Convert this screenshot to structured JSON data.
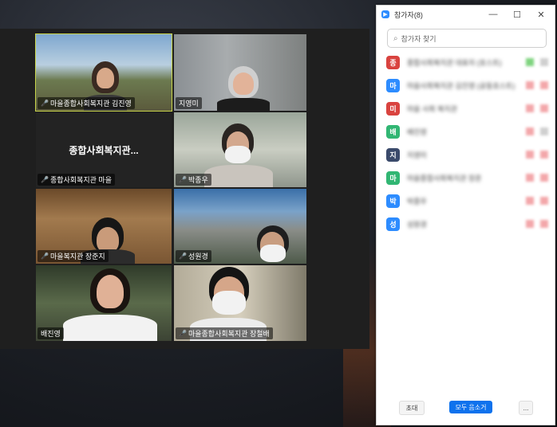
{
  "panel": {
    "title": "참가자(8)",
    "search_placeholder": "참가자 찾기",
    "participants": [
      {
        "initial": "종",
        "name": "종합사회복지관 대표자 (호스트)",
        "color": "#d9433f"
      },
      {
        "initial": "마",
        "name": "마을사회복지관 김진영 (공동호스트)",
        "color": "#2d8cff"
      },
      {
        "initial": "미",
        "name": "마을 사회 복지관",
        "color": "#d9433f"
      },
      {
        "initial": "배",
        "name": "배진영",
        "color": "#31b673"
      },
      {
        "initial": "지",
        "name": "지영미",
        "color": "#3a4a6b"
      },
      {
        "initial": "마",
        "name": "마을종합사회복지관 장준",
        "color": "#31b673"
      },
      {
        "initial": "박",
        "name": "박종우",
        "color": "#2d8cff"
      },
      {
        "initial": "성",
        "name": "성원경",
        "color": "#2d8cff"
      }
    ],
    "footer": {
      "invite": "초대",
      "mute_all": "모두 음소거",
      "more": "..."
    },
    "window_buttons": {
      "minimize": "—",
      "maximize": "☐",
      "close": "✕"
    }
  },
  "tiles": [
    {
      "name": "마을종합사회복지관 김진영",
      "muted": true
    },
    {
      "name": "지영미",
      "muted": false
    },
    {
      "center": "종합사회복지관...",
      "name": "종합사회복지관 마을",
      "muted": true
    },
    {
      "name": "박종우",
      "muted": true
    },
    {
      "name": "마을복지관 장준지",
      "muted": true
    },
    {
      "name": "성원경",
      "muted": true
    },
    {
      "name": "배진영",
      "muted": false
    },
    {
      "name": "마을종합사회복지관 장철배",
      "muted": true
    }
  ]
}
